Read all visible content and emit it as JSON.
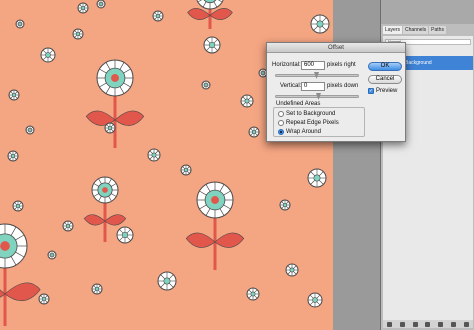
{
  "dialog": {
    "title": "Offset",
    "horizontal_label": "Horizontal:",
    "horizontal_value": "600",
    "horizontal_unit": "pixels right",
    "vertical_label": "Vertical:",
    "vertical_value": "0",
    "vertical_unit": "pixels down",
    "ok_label": "OK",
    "cancel_label": "Cancel",
    "preview_label": "Preview",
    "preview_checked": true,
    "undefined_areas_label": "Undefined Areas",
    "options": [
      {
        "label": "Set to Background",
        "selected": false
      },
      {
        "label": "Repeat Edge Pixels",
        "selected": false
      },
      {
        "label": "Wrap Around",
        "selected": true
      }
    ]
  },
  "panel": {
    "tabs": [
      "Layers",
      "Channels",
      "Paths"
    ],
    "blend_mode": "Normal",
    "lock_label": "Lock:",
    "layer_name": "Background"
  },
  "colors": {
    "canvas": "#f4a582",
    "flower_teal": "#7fd3bf",
    "petal_white": "#ffffff",
    "outline": "#4a4a4a",
    "leaf_red": "#e2574c",
    "accent_blue": "#3d8ee6"
  }
}
